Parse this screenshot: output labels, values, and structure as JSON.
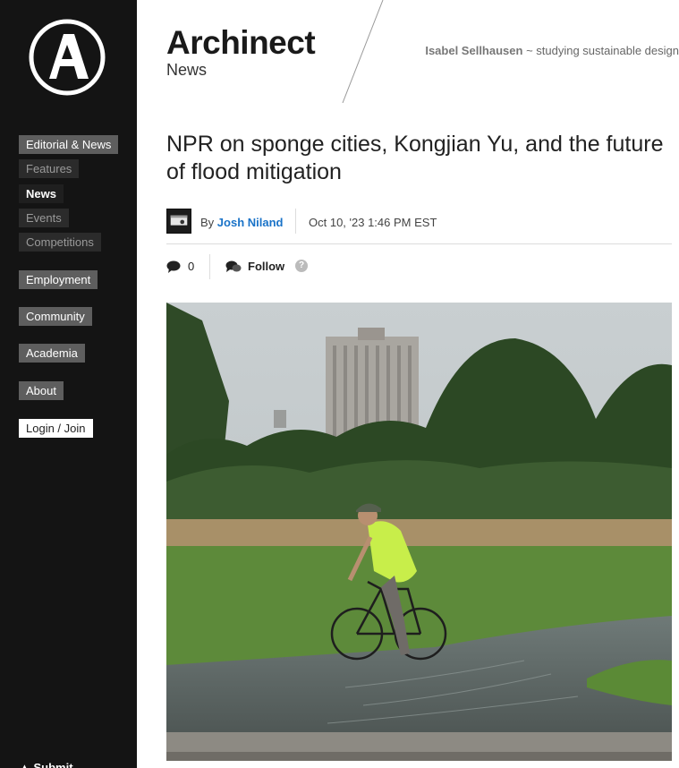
{
  "sidebar": {
    "logo_letter": "A",
    "nav": [
      {
        "label": "Editorial & News"
      },
      {
        "label": "Features"
      },
      {
        "label": "News"
      },
      {
        "label": "Events"
      },
      {
        "label": "Competitions"
      },
      {
        "label": "Employment"
      },
      {
        "label": "Community"
      },
      {
        "label": "Academia"
      },
      {
        "label": "About"
      },
      {
        "label": "Login / Join"
      }
    ],
    "submit_label": "Submit"
  },
  "header": {
    "brand": "Archinect",
    "section": "News",
    "user_name": "Isabel Sellhausen",
    "user_tagline": " ~ studying sustainable design"
  },
  "article": {
    "title": "NPR on sponge cities, Kongjian Yu, and the future of flood mitigation",
    "by_prefix": "By ",
    "author": "Josh Niland",
    "date": "Oct 10, '23 1:46 PM EST",
    "comment_count": "0",
    "follow_label": "Follow",
    "help_glyph": "?"
  },
  "colors": {
    "sidebar_bg": "#141414",
    "link_blue": "#1a73c8",
    "nav_primary_bg": "#5e5e5e"
  },
  "icons": [
    "archinect-logo-icon",
    "comment-icon",
    "follow-icon",
    "help-icon",
    "submit-arrow-icon"
  ]
}
